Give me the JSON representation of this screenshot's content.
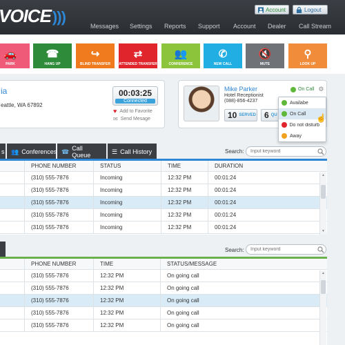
{
  "app": {
    "logo_text": "VOICE",
    "logo_waves": ")))"
  },
  "header": {
    "account_label": "Account",
    "logout_label": "Logout",
    "nav": [
      "Messages",
      "Settings",
      "Reports",
      "Support",
      "Account",
      "Dealer",
      "Call Stream"
    ]
  },
  "actions": [
    {
      "label": "PARK",
      "icon": "car-icon",
      "glyph": "🚗",
      "color": "#ef5a78"
    },
    {
      "label": "HANG UP",
      "icon": "hang-up-icon",
      "glyph": "☎",
      "color": "#2e8b3a"
    },
    {
      "label": "BLIND TRANSFER",
      "icon": "blind-transfer-icon",
      "glyph": "↪",
      "color": "#f07b1f"
    },
    {
      "label": "ATTENDED TRANSFER",
      "icon": "attended-transfer-icon",
      "glyph": "⇄",
      "color": "#e0252d"
    },
    {
      "label": "CONFERENCE",
      "icon": "conference-icon",
      "glyph": "👥",
      "color": "#8cc43c"
    },
    {
      "label": "NEW CALL",
      "icon": "new-call-icon",
      "glyph": "✆",
      "color": "#20aee3"
    },
    {
      "label": "MUTE",
      "icon": "mute-icon",
      "glyph": "🔇",
      "color": "#6f7377"
    },
    {
      "label": "LOOK UP",
      "icon": "lookup-icon",
      "glyph": "⚲",
      "color": "#f08c3a"
    }
  ],
  "caller": {
    "name_partial": "ia",
    "location_partial": "eattle, WA 67892",
    "timer": "00:03:25",
    "status": "Connected",
    "add_favorite": "Add to Favorite",
    "send_message": "Send Mesage"
  },
  "agent": {
    "name": "Mike Parker",
    "title": "Hotel Receptionist",
    "phone": "(088)-856-4237",
    "status": "On Call",
    "served_count": "10",
    "served_label": "SERVED",
    "queue_count": "6",
    "queue_label": "QU"
  },
  "status_menu": [
    {
      "label": "Availabe",
      "color": "#5fb83a"
    },
    {
      "label": "On Call",
      "color": "#5fb83a"
    },
    {
      "label": "Do not disturb",
      "color": "#e0252d"
    },
    {
      "label": "Away",
      "color": "#f0a21f"
    }
  ],
  "tabs": [
    {
      "label": "s",
      "icon": ""
    },
    {
      "label": "Conferences",
      "icon": "conferences-icon",
      "glyph": "👥"
    },
    {
      "label": "Call Queue",
      "icon": "call-queue-icon",
      "glyph": "☎"
    },
    {
      "label": "Call History",
      "icon": "call-history-icon",
      "glyph": "☰"
    }
  ],
  "search": {
    "label": "Search:",
    "placeholder": "Input keyword"
  },
  "table1": {
    "bar_color": "#2e86d6",
    "columns": [
      "PHONE NUMBER",
      "STATUS",
      "TIME",
      "DURATION"
    ],
    "rows": [
      [
        "(310) 555-7876",
        "Incoming",
        "12:32 PM",
        "00:01:24"
      ],
      [
        "(310) 555-7876",
        "Incoming",
        "12:32 PM",
        "00:01:24"
      ],
      [
        "(310) 555-7876",
        "Incoming",
        "12:32 PM",
        "00:01:24"
      ],
      [
        "(310) 555-7876",
        "Incoming",
        "12:32 PM",
        "00:01:24"
      ],
      [
        "(310) 555-7876",
        "Incoming",
        "12:32 PM",
        "00:01:24"
      ]
    ]
  },
  "table2": {
    "bar_color": "#6ab04c",
    "columns": [
      "PHONE NUMBER",
      "TIME",
      "STATUS/MESSAGE"
    ],
    "rows": [
      [
        "(310) 555-7876",
        "12:32 PM",
        "On going call"
      ],
      [
        "(310) 555-7876",
        "12:32 PM",
        "On going call"
      ],
      [
        "(310) 555-7876",
        "12:32 PM",
        "On going call"
      ],
      [
        "(310) 555-7876",
        "12:32 PM",
        "On going call"
      ],
      [
        "(310) 555-7876",
        "12:32 PM",
        "On going call"
      ]
    ]
  }
}
